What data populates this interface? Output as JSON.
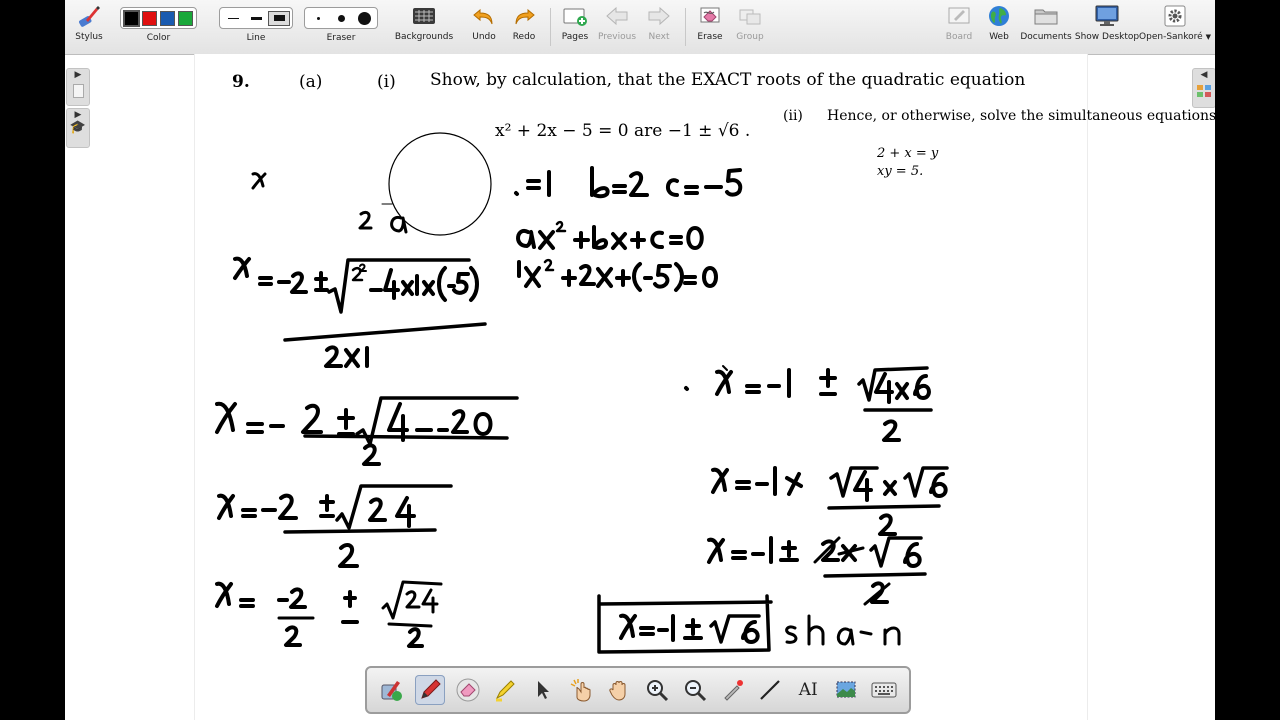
{
  "toolbar": {
    "stylus": "Stylus",
    "color": "Color",
    "line": "Line",
    "eraser": "Eraser",
    "backgrounds": "Backgrounds",
    "undo": "Undo",
    "redo": "Redo",
    "pages": "Pages",
    "previous": "Previous",
    "next": "Next",
    "erase": "Erase",
    "group": "Group",
    "board": "Board",
    "web": "Web",
    "documents": "Documents",
    "show_desktop": "Show Desktop",
    "open_sankore": "Open-Sankoré",
    "colors": [
      "#000000",
      "#e01010",
      "#1a5bb0",
      "#1aa83a"
    ],
    "selected_color": "#000000"
  },
  "document": {
    "question_number": "9.",
    "part_a": "(a)",
    "part_i": "(i)",
    "part_i_text": "Show, by calculation, that the EXACT roots of the quadratic equation",
    "equation": "x² + 2x − 5 = 0 are −1 ± √6 .",
    "part_ii": "(ii)",
    "part_ii_text": "Hence, or otherwise, solve the simultaneous equations",
    "sim_eq_1": "2 + x = y",
    "sim_eq_2": "xy = 5."
  },
  "palette": {
    "tools": [
      "pen-tools",
      "pen",
      "eraser",
      "highlighter",
      "select",
      "interact",
      "hand",
      "zoom-in",
      "zoom-out",
      "laser-pointer",
      "line",
      "text",
      "capture",
      "virtual-keyboard"
    ],
    "text_tool_glyph": "AI"
  }
}
